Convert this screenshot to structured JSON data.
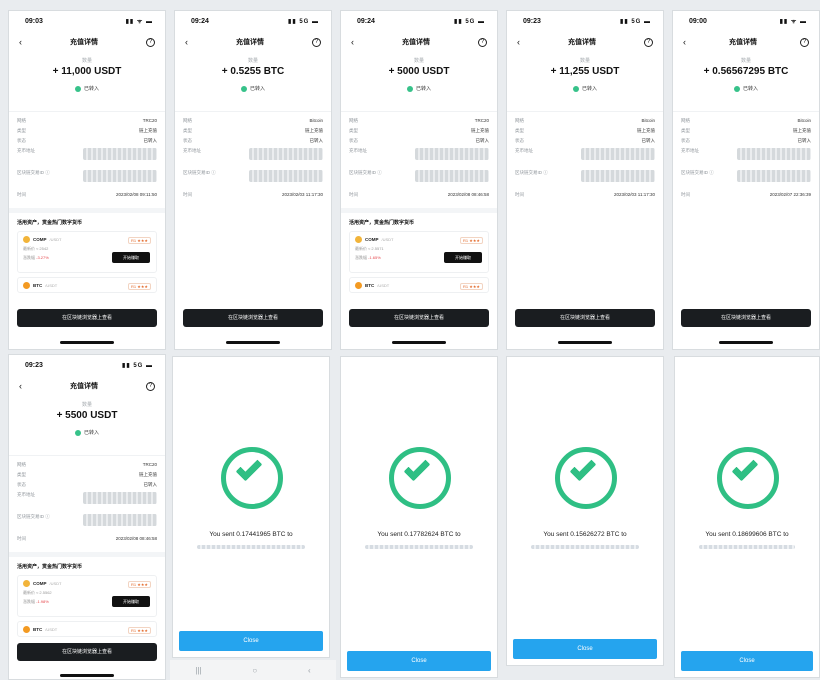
{
  "deposit_screens": [
    {
      "time": "09:03",
      "signal": "▮▮ ᯤ ▬",
      "title": "充值详情",
      "amount_label": "数量",
      "amount": "+ 11,000 USDT",
      "status": "已转入",
      "rows": [
        {
          "label": "网络",
          "value": "TRC20"
        },
        {
          "label": "类型",
          "value": "链上充值"
        },
        {
          "label": "状态",
          "value": "已转入"
        },
        {
          "label": "充币地址",
          "value": ""
        },
        {
          "label": "区块链交易ID ⓘ",
          "value": ""
        },
        {
          "label": "时间",
          "value": "2023/02/08 09:11:50"
        }
      ],
      "promo_title": "活用资产，赏金热门数字货币",
      "card": {
        "coin": "COMP",
        "pair": "/USDT",
        "risk": "R1 ★★★",
        "l1": "最新价 ≈ 2542",
        "l2": "涨跌幅",
        "change": "-3.27%",
        "btn": "开始赚取"
      },
      "card2": {
        "coin": "BTC",
        "pair": "/USDT",
        "risk": "R1 ★★★"
      },
      "bottom_btn": "在区块链浏览器上查看"
    },
    {
      "time": "09:24",
      "signal": "▮▮ 5G ▬",
      "title": "充值详情",
      "amount_label": "数量",
      "amount": "+ 0.5255 BTC",
      "status": "已转入",
      "rows": [
        {
          "label": "网络",
          "value": "Bitcoin"
        },
        {
          "label": "类型",
          "value": "链上充值"
        },
        {
          "label": "状态",
          "value": "已转入"
        },
        {
          "label": "充币地址",
          "value": ""
        },
        {
          "label": "区块链交易ID ⓘ",
          "value": ""
        },
        {
          "label": "时间",
          "value": "2023/02/03 11:17:30"
        }
      ],
      "bottom_btn": "在区块链浏览器上查看"
    },
    {
      "time": "09:24",
      "signal": "▮▮ 5G ▬",
      "title": "充值详情",
      "amount_label": "数量",
      "amount": "+ 5000 USDT",
      "status": "已转入",
      "rows": [
        {
          "label": "网络",
          "value": "TRC20"
        },
        {
          "label": "类型",
          "value": "链上充值"
        },
        {
          "label": "状态",
          "value": "已转入"
        },
        {
          "label": "充币地址",
          "value": ""
        },
        {
          "label": "区块链交易ID ⓘ",
          "value": ""
        },
        {
          "label": "时间",
          "value": "2023/02/08 08:46:58"
        }
      ],
      "promo_title": "活用资产，赏金热门数字货币",
      "card": {
        "coin": "COMP",
        "pair": "/USDT",
        "risk": "R1 ★★★",
        "l1": "最新价 ≈ 2.5571",
        "l2": "涨跌幅",
        "change": "-1.65%",
        "btn": "开始赚取"
      },
      "card2": {
        "coin": "BTC",
        "pair": "/USDT",
        "risk": "R1 ★★★"
      },
      "bottom_btn": "在区块链浏览器上查看"
    },
    {
      "time": "09:23",
      "signal": "▮▮ 5G ▬",
      "title": "充值详情",
      "amount_label": "数量",
      "amount": "+ 11,255 USDT",
      "status": "已转入",
      "rows": [
        {
          "label": "网络",
          "value": "Bitcoin"
        },
        {
          "label": "类型",
          "value": "链上充值"
        },
        {
          "label": "状态",
          "value": "已转入"
        },
        {
          "label": "充币地址",
          "value": ""
        },
        {
          "label": "区块链交易ID ⓘ",
          "value": ""
        },
        {
          "label": "时间",
          "value": "2023/02/03 11:17:30"
        }
      ],
      "bottom_btn": "在区块链浏览器上查看"
    },
    {
      "time": "09:00",
      "signal": "▮▮ ᯤ ▬",
      "title": "充值详情",
      "amount_label": "数量",
      "amount": "+ 0.56567295 BTC",
      "status": "已转入",
      "rows": [
        {
          "label": "网络",
          "value": "Bitcoin"
        },
        {
          "label": "类型",
          "value": "链上充值"
        },
        {
          "label": "状态",
          "value": "已转入"
        },
        {
          "label": "充币地址",
          "value": ""
        },
        {
          "label": "区块链交易ID ⓘ",
          "value": ""
        },
        {
          "label": "时间",
          "value": "2023/02/07 22:36:39"
        }
      ],
      "bottom_btn": "在区块链浏览器上查看"
    },
    {
      "time": "09:23",
      "signal": "▮▮ 5G ▬",
      "title": "充值详情",
      "amount_label": "数量",
      "amount": "+ 5500 USDT",
      "status": "已转入",
      "rows": [
        {
          "label": "网络",
          "value": "TRC20"
        },
        {
          "label": "类型",
          "value": "链上充值"
        },
        {
          "label": "状态",
          "value": "已转入"
        },
        {
          "label": "充币地址",
          "value": ""
        },
        {
          "label": "区块链交易ID ⓘ",
          "value": ""
        },
        {
          "label": "时间",
          "value": "2023/02/08 08:46:58"
        }
      ],
      "promo_title": "活用资产，赏金热门数字货币",
      "card": {
        "coin": "COMP",
        "pair": "/USDT",
        "risk": "R1 ★★★",
        "l1": "最新价 ≈ 2.5562",
        "l2": "涨跌幅",
        "change": "-1.98%",
        "btn": "开始赚取"
      },
      "card2": {
        "coin": "BTC",
        "pair": "/USDT",
        "risk": "R1 ★★★"
      },
      "bottom_btn": "在区块链浏览器上查看"
    }
  ],
  "sent_screens": [
    {
      "text": "You sent 0.17441965 BTC to",
      "button": "Close"
    },
    {
      "text": "You sent 0.17782624 BTC to",
      "button": "Close"
    },
    {
      "text": "You sent 0.15626272 BTC to",
      "button": "Close"
    },
    {
      "text": "You sent 0.18699606 BTC to",
      "button": "Close"
    }
  ],
  "android_nav": {
    "recents": "|||",
    "home": "○",
    "back": "‹"
  },
  "colors": {
    "success": "#2fbf84",
    "close_button": "#25a4ee",
    "dark_button": "#1a1d20"
  }
}
